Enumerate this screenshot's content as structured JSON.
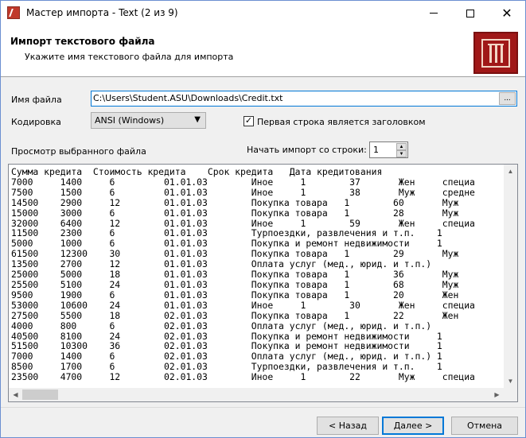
{
  "window": {
    "title": "Мастер импорта - Text (2 из 9)"
  },
  "banner": {
    "title": "Импорт текстового файла",
    "subtitle": "Укажите имя текстового файла для импорта"
  },
  "form": {
    "file_label": "Имя файла",
    "file_value": "C:\\Users\\Student.ASU\\Downloads\\Credit.txt",
    "browse_label": "...",
    "encoding_label": "Кодировка",
    "encoding_value": "ANSI (Windows)",
    "header_checkbox_label": "Первая строка является заголовком",
    "header_checkbox_checked": true,
    "preview_label": "Просмотр выбранного файла",
    "start_row_label": "Начать импорт со строки:",
    "start_row_value": "1"
  },
  "preview": {
    "lines": [
      "Сумма кредита  Стоимость кредита    Срок кредита   Дата кредитования",
      "7000     1400     6         01.01.03        Иное     1        37       Жен     специа",
      "7500     1500     6         01.01.03        Иное     1        38       Муж     средне",
      "14500    2900     12        01.01.03        Покупка товара   1        60       Муж",
      "15000    3000     6         01.01.03        Покупка товара   1        28       Муж",
      "32000    6400     12        01.01.03        Иное     1        59       Жен     специа",
      "11500    2300     6         01.01.03        Турпоездки, развлечения и т.п.    1",
      "5000     1000     6         01.01.03        Покупка и ремонт недвижимости     1",
      "61500    12300    30        01.01.03        Покупка товара   1        29       Муж",
      "13500    2700     12        01.01.03        Оплата услуг (мед., юрид. и т.п.)",
      "25000    5000     18        01.01.03        Покупка товара   1        36       Муж",
      "25500    5100     24        01.01.03        Покупка товара   1        68       Муж",
      "9500     1900     6         01.01.03        Покупка товара   1        20       Жен",
      "53000    10600    24        01.01.03        Иное     1        30       Жен     специа",
      "27500    5500     18        02.01.03        Покупка товара   1        22       Жен",
      "4000     800      6         02.01.03        Оплата услуг (мед., юрид. и т.п.)",
      "40500    8100     24        02.01.03        Покупка и ремонт недвижимости     1",
      "51500    10300    36        02.01.03        Покупка и ремонт недвижимости     1",
      "7000     1400     6         02.01.03        Оплата услуг (мед., юрид. и т.п.) 1",
      "8500     1700     6         02.01.03        Турпоездки, развлечения и т.п.    1",
      "23500    4700     12        02.01.03        Иное     1        22       Муж     специа"
    ]
  },
  "buttons": {
    "back": "< Назад",
    "next": "Далее >",
    "cancel": "Отмена"
  }
}
